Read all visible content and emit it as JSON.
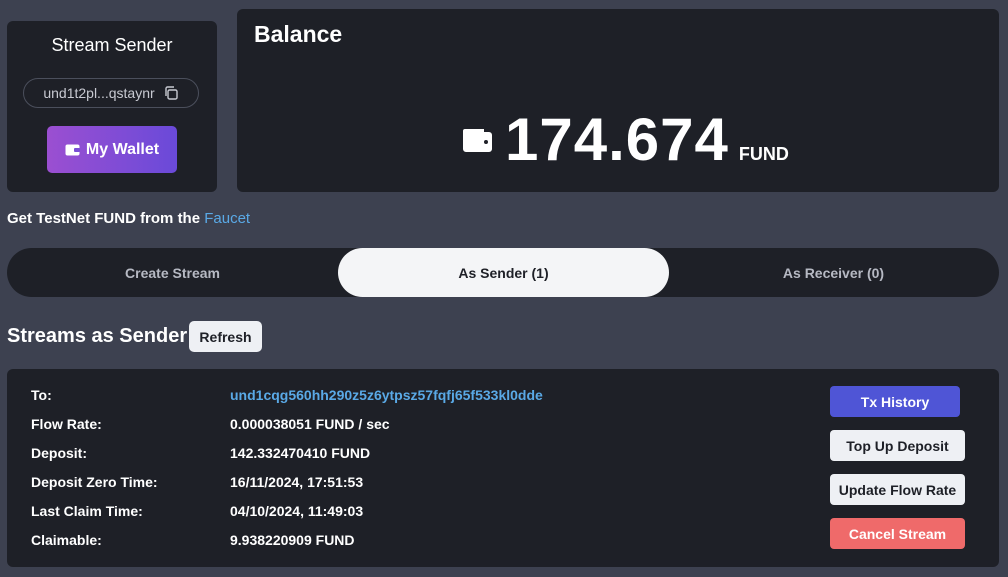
{
  "sender": {
    "title": "Stream Sender",
    "address": "und1t2pl...qstaynr",
    "wallet_button": "My Wallet"
  },
  "balance": {
    "title": "Balance",
    "value": "174.674",
    "unit": "FUND"
  },
  "faucet": {
    "prefix": "Get TestNet FUND from the ",
    "link": "Faucet"
  },
  "tabs": [
    {
      "label": "Create Stream",
      "active": false
    },
    {
      "label": "As Sender (1)",
      "active": true
    },
    {
      "label": "As Receiver (0)",
      "active": false
    }
  ],
  "streams": {
    "header": "Streams as Sender",
    "refresh": "Refresh",
    "rows": [
      {
        "label": "To:",
        "value": "und1cqg560hh290z5z6ytpsz57fqfj65f533kl0dde"
      },
      {
        "label": "Flow Rate:",
        "value": "0.000038051 FUND / sec"
      },
      {
        "label": "Deposit:",
        "value": "142.332470410 FUND"
      },
      {
        "label": "Deposit Zero Time:",
        "value": "16/11/2024, 17:51:53"
      },
      {
        "label": "Last Claim Time:",
        "value": "04/10/2024, 11:49:03"
      },
      {
        "label": "Claimable:",
        "value": "9.938220909 FUND"
      }
    ],
    "actions": {
      "tx_history": "Tx History",
      "top_up": "Top Up Deposit",
      "update_flow": "Update Flow Rate",
      "cancel": "Cancel Stream"
    }
  },
  "colors": {
    "page_bg": "#3d4150",
    "card_bg": "#1e2027",
    "link": "#5aa9e6",
    "primary": "#4f55d6",
    "danger": "#ef6a6a",
    "wallet_gradient_start": "#9b4fd1",
    "wallet_gradient_end": "#6a4ad9"
  },
  "icons": {
    "copy": "copy-icon",
    "wallet": "wallet-icon"
  }
}
